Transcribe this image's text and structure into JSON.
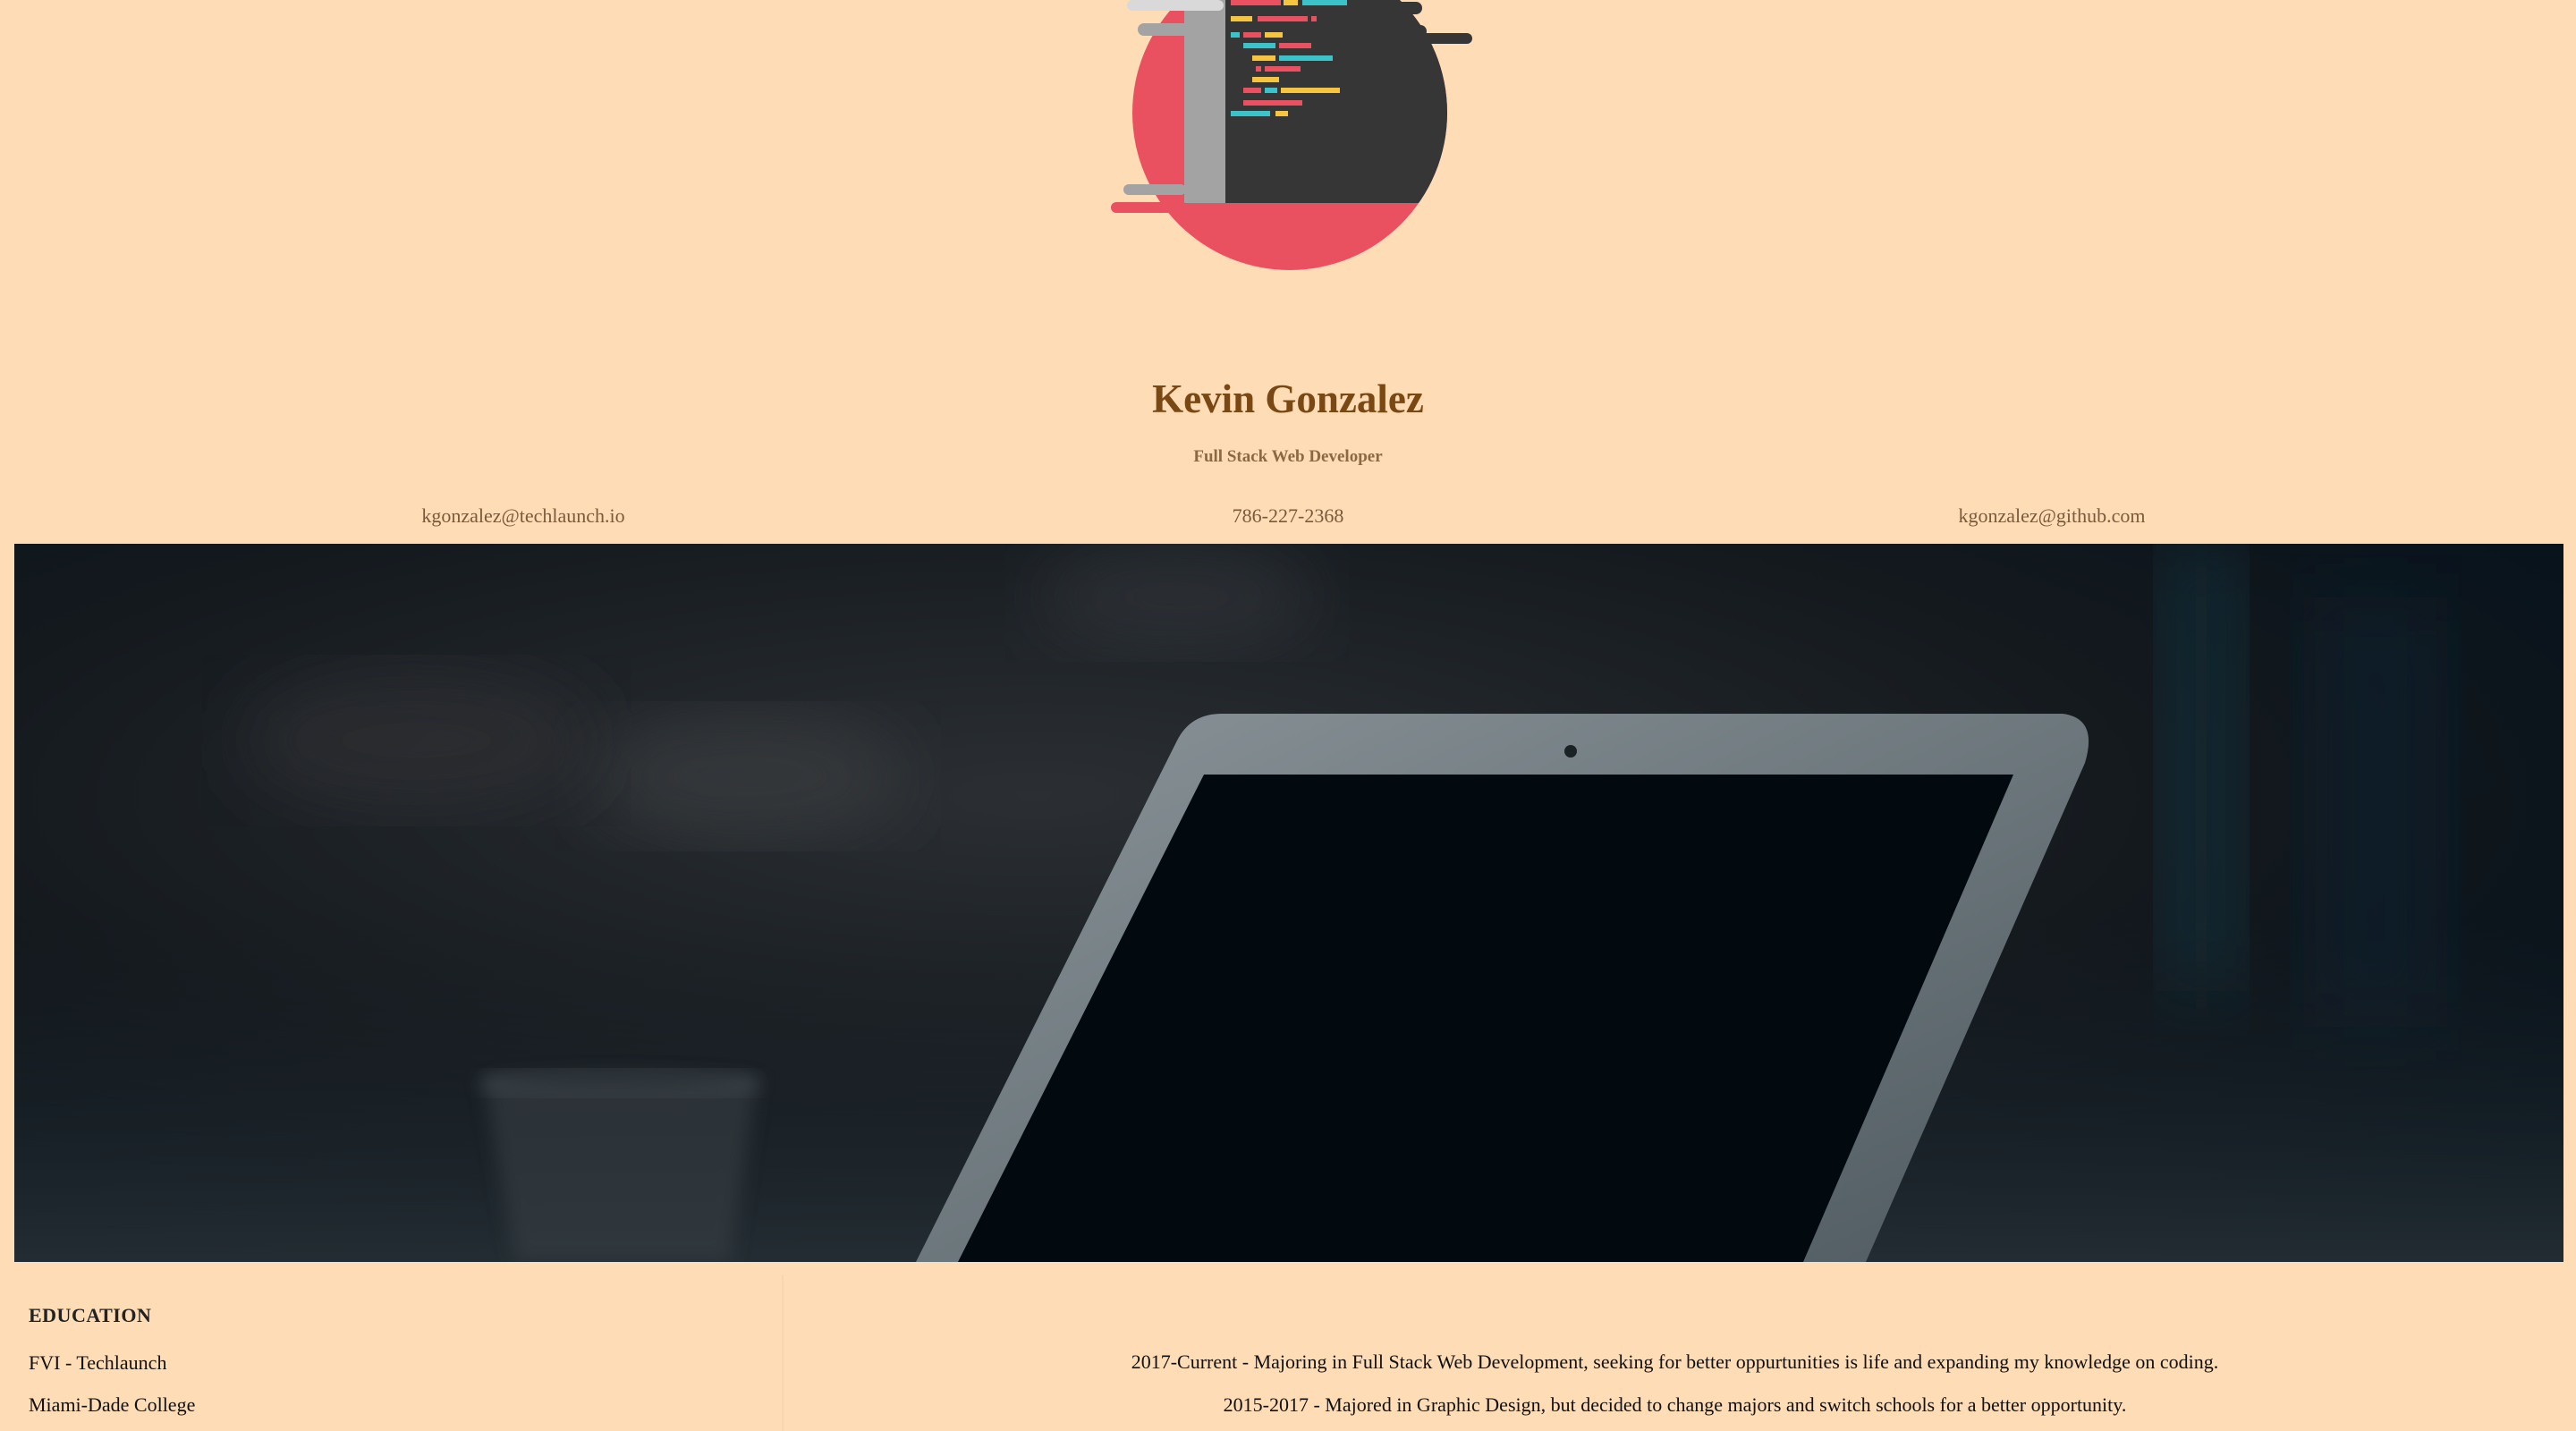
{
  "profile": {
    "name": "Kevin Gonzalez",
    "title": "Full Stack Web Developer"
  },
  "contacts": {
    "email": "kgonzalez@techlaunch.io",
    "phone": "786-227-2368",
    "github": "kgonzalez@github.com"
  },
  "education": {
    "heading": "EDUCATION",
    "entries": [
      {
        "school": "FVI - Techlaunch",
        "description": "2017-Current - Majoring in Full Stack Web Development, seeking for better oppurtunities is life and expanding my knowledge on coding."
      },
      {
        "school": "Miami-Dade College",
        "description": "2015-2017 - Majored in Graphic Design, but decided to change majors and switch schools for a better opportunity."
      }
    ]
  },
  "colors": {
    "background": "#fedcb6",
    "name_text": "#7a4813",
    "logo_red": "#ea5160",
    "logo_dark": "#363636",
    "logo_gray": "#a3a3a3"
  },
  "icons": {
    "logo": "code-editor-logo-icon",
    "hero": "laptop-photo"
  }
}
